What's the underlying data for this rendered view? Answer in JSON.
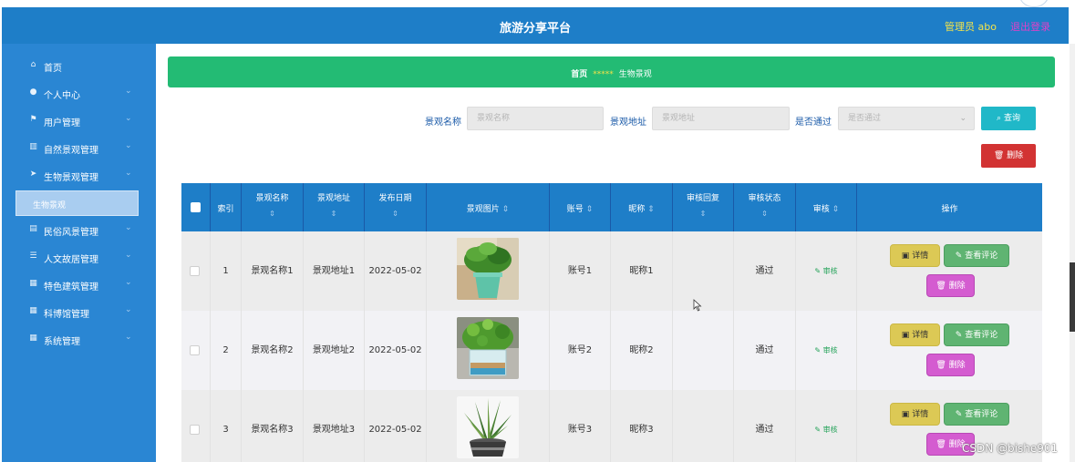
{
  "header": {
    "title": "旅游分享平台",
    "user": "管理员 abo",
    "logout": "退出登录"
  },
  "sidebar": {
    "items": [
      {
        "label": "首页",
        "icon": "home-icon"
      },
      {
        "label": "个人中心",
        "icon": "user-icon"
      },
      {
        "label": "用户管理",
        "icon": "flag-icon"
      },
      {
        "label": "自然景观管理",
        "icon": "bars-icon"
      },
      {
        "label": "生物景观管理",
        "icon": "send-icon"
      },
      {
        "label": "民俗风景管理",
        "icon": "card-icon"
      },
      {
        "label": "人文故居管理",
        "icon": "list-icon"
      },
      {
        "label": "特色建筑管理",
        "icon": "grid-icon"
      },
      {
        "label": "科博馆管理",
        "icon": "grid-icon"
      },
      {
        "label": "系统管理",
        "icon": "grid-icon"
      }
    ],
    "active_sub": "生物景观"
  },
  "breadcrumb": {
    "home": "首页",
    "sep": "*****",
    "current": "生物景观"
  },
  "search": {
    "name_label": "景观名称",
    "name_placeholder": "景观名称",
    "addr_label": "景观地址",
    "addr_placeholder": "景观地址",
    "pass_label": "是否通过",
    "pass_placeholder": "是否通过",
    "query_label": "查询",
    "delete_label": "删除"
  },
  "table": {
    "headers": {
      "index": "索引",
      "name": "景观名称",
      "address": "景观地址",
      "date": "发布日期",
      "image": "景观图片",
      "account": "账号",
      "nickname": "昵称",
      "reply": "审核回复",
      "status": "审核状态",
      "audit": "审核",
      "ops": "操作"
    },
    "sort_icon": "⇕",
    "rows": [
      {
        "index": "1",
        "name": "景观名称1",
        "address": "景观地址1",
        "date": "2022-05-02",
        "account": "账号1",
        "nickname": "昵称1",
        "reply": "",
        "status": "通过",
        "audit": "审核"
      },
      {
        "index": "2",
        "name": "景观名称2",
        "address": "景观地址2",
        "date": "2022-05-02",
        "account": "账号2",
        "nickname": "昵称2",
        "reply": "",
        "status": "通过",
        "audit": "审核"
      },
      {
        "index": "3",
        "name": "景观名称3",
        "address": "景观地址3",
        "date": "2022-05-02",
        "account": "账号3",
        "nickname": "昵称3",
        "reply": "",
        "status": "通过",
        "audit": "审核"
      }
    ],
    "actions": {
      "detail": "详情",
      "comments": "查看评论",
      "delete": "删除"
    }
  },
  "watermark": "CSDN @bishe901",
  "colors": {
    "header": "#1e7ec8",
    "sidebar": "#2a86d3",
    "breadcrumb": "#23bb74",
    "query": "#20b8c8",
    "danger": "#d23333"
  }
}
